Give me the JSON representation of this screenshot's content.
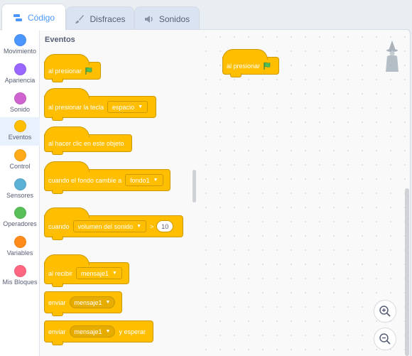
{
  "tabs": [
    {
      "label": "Código",
      "icon": "code-icon",
      "active": true
    },
    {
      "label": "Disfraces",
      "icon": "brush-icon",
      "active": false
    },
    {
      "label": "Sonidos",
      "icon": "speaker-icon",
      "active": false
    }
  ],
  "categories": [
    {
      "label": "Movimiento",
      "color": "#4c97ff"
    },
    {
      "label": "Apariencia",
      "color": "#9966ff"
    },
    {
      "label": "Sonido",
      "color": "#cf63cf"
    },
    {
      "label": "Eventos",
      "color": "#ffbf00",
      "selected": true
    },
    {
      "label": "Control",
      "color": "#ffab19"
    },
    {
      "label": "Sensores",
      "color": "#5cb1d6"
    },
    {
      "label": "Operadores",
      "color": "#59c059"
    },
    {
      "label": "Variables",
      "color": "#ff8c1a"
    },
    {
      "label": "Mis Bloques",
      "color": "#ff6680"
    }
  ],
  "palette": {
    "title": "Eventos",
    "blocks": {
      "flag_clicked": "al presionar",
      "key_pressed": "al presionar la tecla",
      "key_option": "espacio",
      "sprite_clicked": "al hacer clic en este objeto",
      "backdrop_switch": "cuando el fondo cambie a",
      "backdrop_option": "fondo1",
      "greater_when": "cuando",
      "greater_option": "volumen del sonido",
      "greater_symbol": ">",
      "greater_value": "10",
      "receive": "al recibir",
      "receive_option": "mensaje1",
      "broadcast": "enviar",
      "broadcast_option": "mensaje1",
      "broadcast_wait": "enviar",
      "broadcast_wait_option": "mensaje1",
      "broadcast_wait_suffix": "y esperar"
    }
  },
  "workspace": {
    "script_block": "al presionar"
  },
  "colors": {
    "events": "#ffbf00",
    "events_border": "#cc9900",
    "accent": "#4c97ff",
    "flag": "#4cbf56"
  }
}
